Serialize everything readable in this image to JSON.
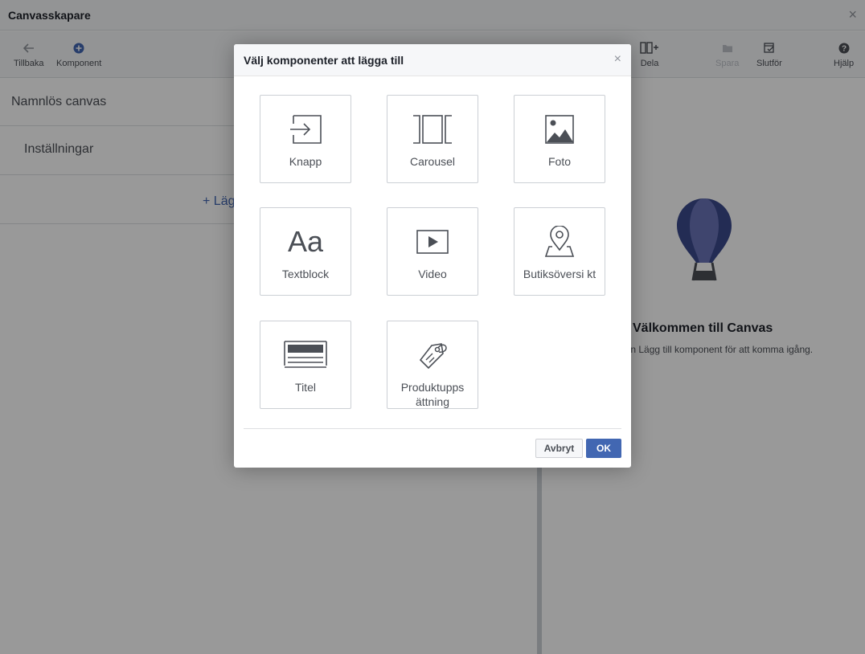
{
  "window": {
    "title": "Canvasskapare",
    "close_glyph": "×"
  },
  "toolbar": {
    "back_label": "Tillbaka",
    "component_label": "Komponent",
    "share_label": "Dela",
    "save_label": "Spara",
    "finish_label": "Slutför",
    "help_label": "Hjälp"
  },
  "left": {
    "canvas_name": "Namnlös canvas",
    "settings_label": "Inställningar",
    "add_component": "+ Läg"
  },
  "right": {
    "welcome_title": "Välkommen till Canvas",
    "welcome_sub": "pen Lägg till komponent för att komma igång."
  },
  "dialog": {
    "title": "Välj komponenter att lägga till",
    "close_glyph": "×",
    "tiles": [
      {
        "label": "Knapp",
        "icon": "button-icon"
      },
      {
        "label": "Carousel",
        "icon": "carousel-icon"
      },
      {
        "label": "Foto",
        "icon": "photo-icon"
      },
      {
        "label": "Textblock",
        "icon": "text-icon",
        "glyph": "Aa"
      },
      {
        "label": "Video",
        "icon": "video-icon"
      },
      {
        "label": "Butiksöversi kt",
        "icon": "map-pin-icon"
      },
      {
        "label": "Titel",
        "icon": "title-icon"
      },
      {
        "label": "Produktupps ättning",
        "icon": "tag-icon"
      }
    ],
    "cancel_label": "Avbryt",
    "ok_label": "OK"
  },
  "colors": {
    "accent": "#4267b2",
    "balloon_dark": "#3b4a8c",
    "balloon_light": "#6a74b8",
    "icon_gray": "#4b4f56"
  }
}
